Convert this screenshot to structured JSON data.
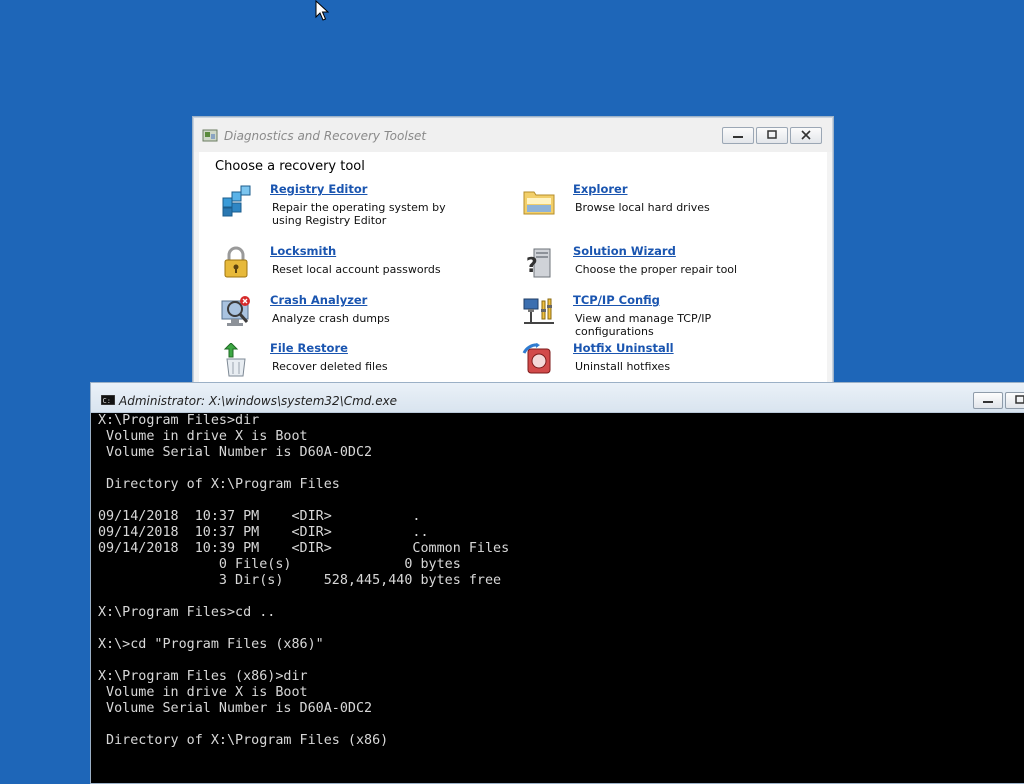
{
  "recovery_window": {
    "title": "Diagnostics and Recovery Toolset",
    "heading": "Choose a recovery tool",
    "tools": [
      {
        "name": "Registry Editor",
        "desc": "Repair the operating system by using Registry Editor",
        "icon": "registry-editor-icon"
      },
      {
        "name": "Explorer",
        "desc": "Browse local hard drives",
        "icon": "explorer-folder-icon"
      },
      {
        "name": "Locksmith",
        "desc": "Reset local account passwords",
        "icon": "padlock-icon"
      },
      {
        "name": "Solution Wizard",
        "desc": "Choose the proper repair tool",
        "icon": "solution-wizard-icon"
      },
      {
        "name": "Crash Analyzer",
        "desc": "Analyze crash dumps",
        "icon": "crash-analyzer-icon"
      },
      {
        "name": "TCP/IP Config",
        "desc": "View and manage TCP/IP configurations",
        "icon": "network-config-icon"
      },
      {
        "name": "File Restore",
        "desc": "Recover deleted files",
        "icon": "recycle-bin-restore-icon"
      },
      {
        "name": "Hotfix Uninstall",
        "desc": "Uninstall hotfixes",
        "icon": "hotfix-uninstall-icon"
      }
    ]
  },
  "cmd_window": {
    "title": "Administrator: X:\\windows\\system32\\Cmd.exe",
    "lines": [
      "X:\\Program Files>dir",
      " Volume in drive X is Boot",
      " Volume Serial Number is D60A-0DC2",
      "",
      " Directory of X:\\Program Files",
      "",
      "09/14/2018  10:37 PM    <DIR>          .",
      "09/14/2018  10:37 PM    <DIR>          ..",
      "09/14/2018  10:39 PM    <DIR>          Common Files",
      "               0 File(s)              0 bytes",
      "               3 Dir(s)     528,445,440 bytes free",
      "",
      "X:\\Program Files>cd ..",
      "",
      "X:\\>cd \"Program Files (x86)\"",
      "",
      "X:\\Program Files (x86)>dir",
      " Volume in drive X is Boot",
      " Volume Serial Number is D60A-0DC2",
      "",
      " Directory of X:\\Program Files (x86)",
      ""
    ]
  },
  "colors": {
    "desktop": "#1e66b8",
    "link": "#1a55b0",
    "console_text": "#d8d8d8"
  }
}
